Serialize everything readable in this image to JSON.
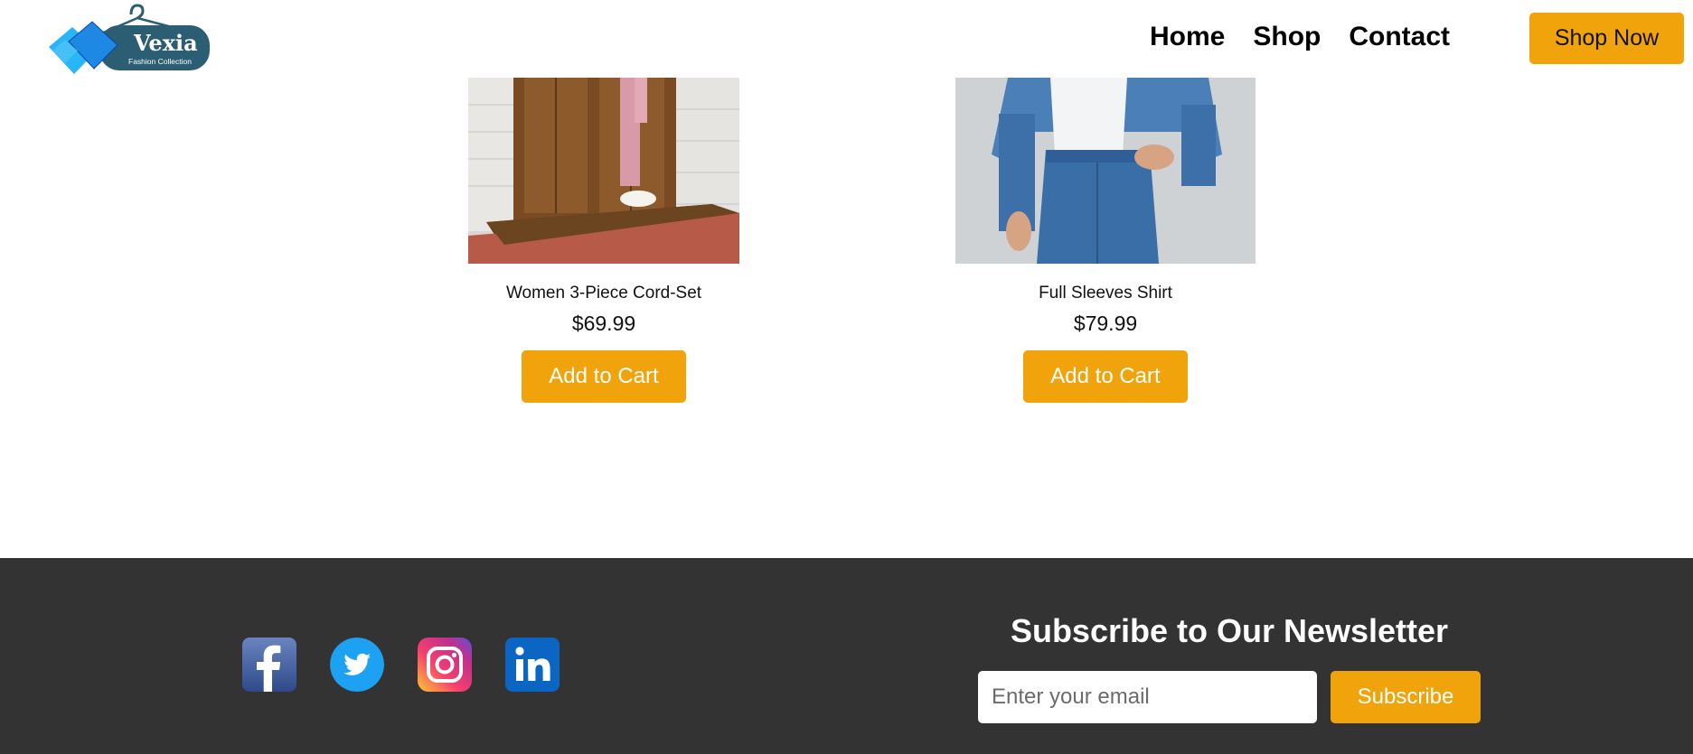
{
  "header": {
    "logo": {
      "brand": "Vexia",
      "tagline": "Fashion Collection"
    },
    "nav": [
      {
        "label": "Home"
      },
      {
        "label": "Shop"
      },
      {
        "label": "Contact"
      }
    ],
    "cta_label": "Shop Now"
  },
  "products": [
    {
      "name": "Women 3-Piece Cord-Set",
      "price": "$69.99",
      "button_label": "Add to Cart"
    },
    {
      "name": "Full Sleeves Shirt",
      "price": "$79.99",
      "button_label": "Add to Cart"
    }
  ],
  "footer": {
    "social": [
      {
        "icon": "facebook-icon"
      },
      {
        "icon": "twitter-icon"
      },
      {
        "icon": "instagram-icon"
      },
      {
        "icon": "linkedin-icon"
      }
    ],
    "newsletter": {
      "title": "Subscribe to Our Newsletter",
      "email_placeholder": "Enter your email",
      "button_label": "Subscribe"
    }
  },
  "colors": {
    "accent": "#f0a30a",
    "footer_bg": "#333333",
    "logo_teal": "#2b5d73",
    "logo_blue": "#1e88e5"
  }
}
